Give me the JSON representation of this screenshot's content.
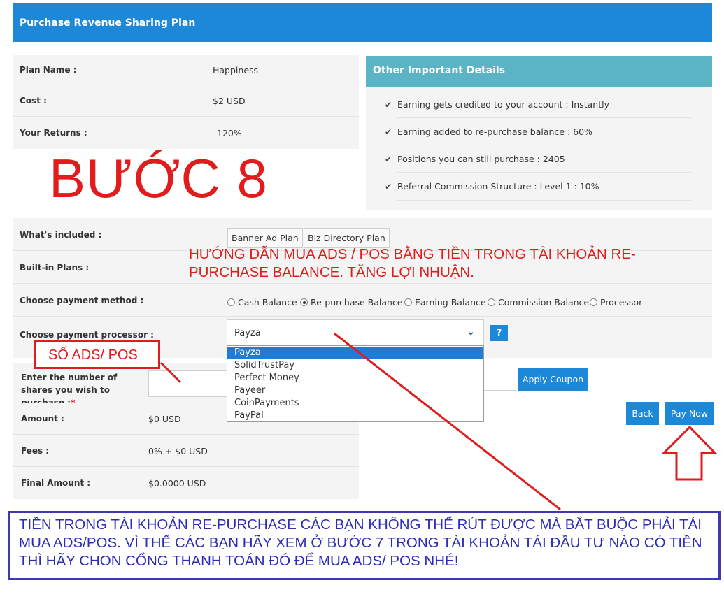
{
  "header": {
    "title": "Purchase Revenue Sharing Plan"
  },
  "plan": {
    "name_label": "Plan Name :",
    "name_value": "Happiness",
    "cost_label": "Cost :",
    "cost_value": "$2 USD",
    "returns_label": "Your Returns :",
    "returns_value": "120%"
  },
  "details": {
    "title": "Other Important Details",
    "items": [
      "Earning gets credited to your account : Instantly",
      "Earning added to re-purchase balance : 60%",
      "Positions you can still purchase : 2405",
      "Referral Commission Structure : Level 1 : 10%"
    ]
  },
  "annotations": {
    "step": "BƯỚC 8",
    "red_note": "HƯỚNG DẪN MUA ADS / POS BẰNG TIỀN TRONG TÀI KHOẢN RE-PURCHASE BALANCE. TĂNG LỢI NHUẬN.",
    "shares_box": "SỐ ADS/ POS",
    "bottom_note": "TIỀN TRONG TÀI KHOẢN RE-PURCHASE CÁC BẠN KHÔNG THỂ RÚT ĐƯỢC MÀ BẮT BUỘC PHẢI TÁI MUA ADS/POS. VÌ THẾ CÁC BẠN HÃY XEM Ở BƯỚC 7 TRONG TÀI KHOẢN TÁI ĐẦU TƯ NÀO CÓ TIỀN THÌ HÃY CHON CỔNG THANH TOÁN ĐÓ ĐỂ MUA ADS/ POS NHÉ!"
  },
  "form": {
    "included_label": "What's included :",
    "included_tags": [
      "Banner Ad Plan",
      "Biz Directory Plan"
    ],
    "builtin_label": "Built-in Plans :",
    "method_label": "Choose payment method :",
    "methods": [
      "Cash Balance",
      "Re-purchase Balance",
      "Earning Balance",
      "Commission Balance",
      "Processor"
    ],
    "selected_method": "Re-purchase Balance",
    "processor_label": "Choose payment processor :",
    "processor_value": "Payza",
    "help_label": "?",
    "processor_options": [
      "Payza",
      "SolidTrustPay",
      "Perfect Money",
      "Payeer",
      "CoinPayments",
      "PayPal"
    ],
    "shares_label": "Enter the number of shares you wish to purchase :",
    "required_mark": "*",
    "apply_coupon": "Apply Coupon",
    "amount_label": "Amount :",
    "amount_value": "$0 USD",
    "fees_label": "Fees :",
    "fees_value": "0% + $0 USD",
    "final_label": "Final Amount :",
    "final_value": "$0.0000 USD",
    "back_button": "Back",
    "pay_button": "Pay Now"
  },
  "colors": {
    "accent_blue": "#1e88d8",
    "details_teal": "#5bb4c6",
    "annotation_red": "#e21c1c",
    "note_blue": "#2c2cb8"
  }
}
